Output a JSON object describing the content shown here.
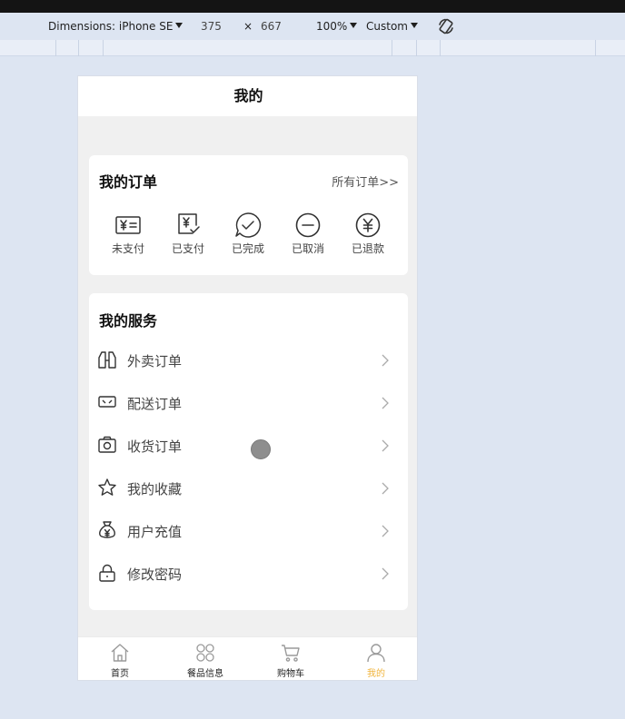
{
  "devtools": {
    "device_label": "Dimensions: iPhone SE",
    "width": "375",
    "times": "×",
    "height": "667",
    "zoom": "100%",
    "throttle": "Custom"
  },
  "page": {
    "title": "我的"
  },
  "orders": {
    "title": "我的订单",
    "all_link": "所有订单>>",
    "items": [
      {
        "label": "未支付",
        "icon": "yen-bill-icon"
      },
      {
        "label": "已支付",
        "icon": "yen-receipt-check-icon"
      },
      {
        "label": "已完成",
        "icon": "check-bubble-icon"
      },
      {
        "label": "已取消",
        "icon": "minus-circle-icon"
      },
      {
        "label": "已退款",
        "icon": "yen-circle-icon"
      }
    ]
  },
  "services": {
    "title": "我的服务",
    "items": [
      {
        "label": "外卖订单",
        "icon": "takeout-icon"
      },
      {
        "label": "配送订单",
        "icon": "delivery-icon"
      },
      {
        "label": "收货订单",
        "icon": "camera-icon"
      },
      {
        "label": "我的收藏",
        "icon": "star-icon"
      },
      {
        "label": "用户充值",
        "icon": "money-bag-icon"
      },
      {
        "label": "修改密码",
        "icon": "lock-icon"
      }
    ]
  },
  "tabbar": {
    "items": [
      {
        "label": "首页",
        "icon": "home-icon",
        "active": false
      },
      {
        "label": "餐品信息",
        "icon": "grid-icon",
        "active": false
      },
      {
        "label": "购物车",
        "icon": "cart-icon",
        "active": false
      },
      {
        "label": "我的",
        "icon": "user-icon",
        "active": true
      }
    ]
  },
  "colors": {
    "accent": "#f0b43c",
    "page_bg": "#f0f0f0",
    "devtools_bg": "#dde5f2"
  }
}
